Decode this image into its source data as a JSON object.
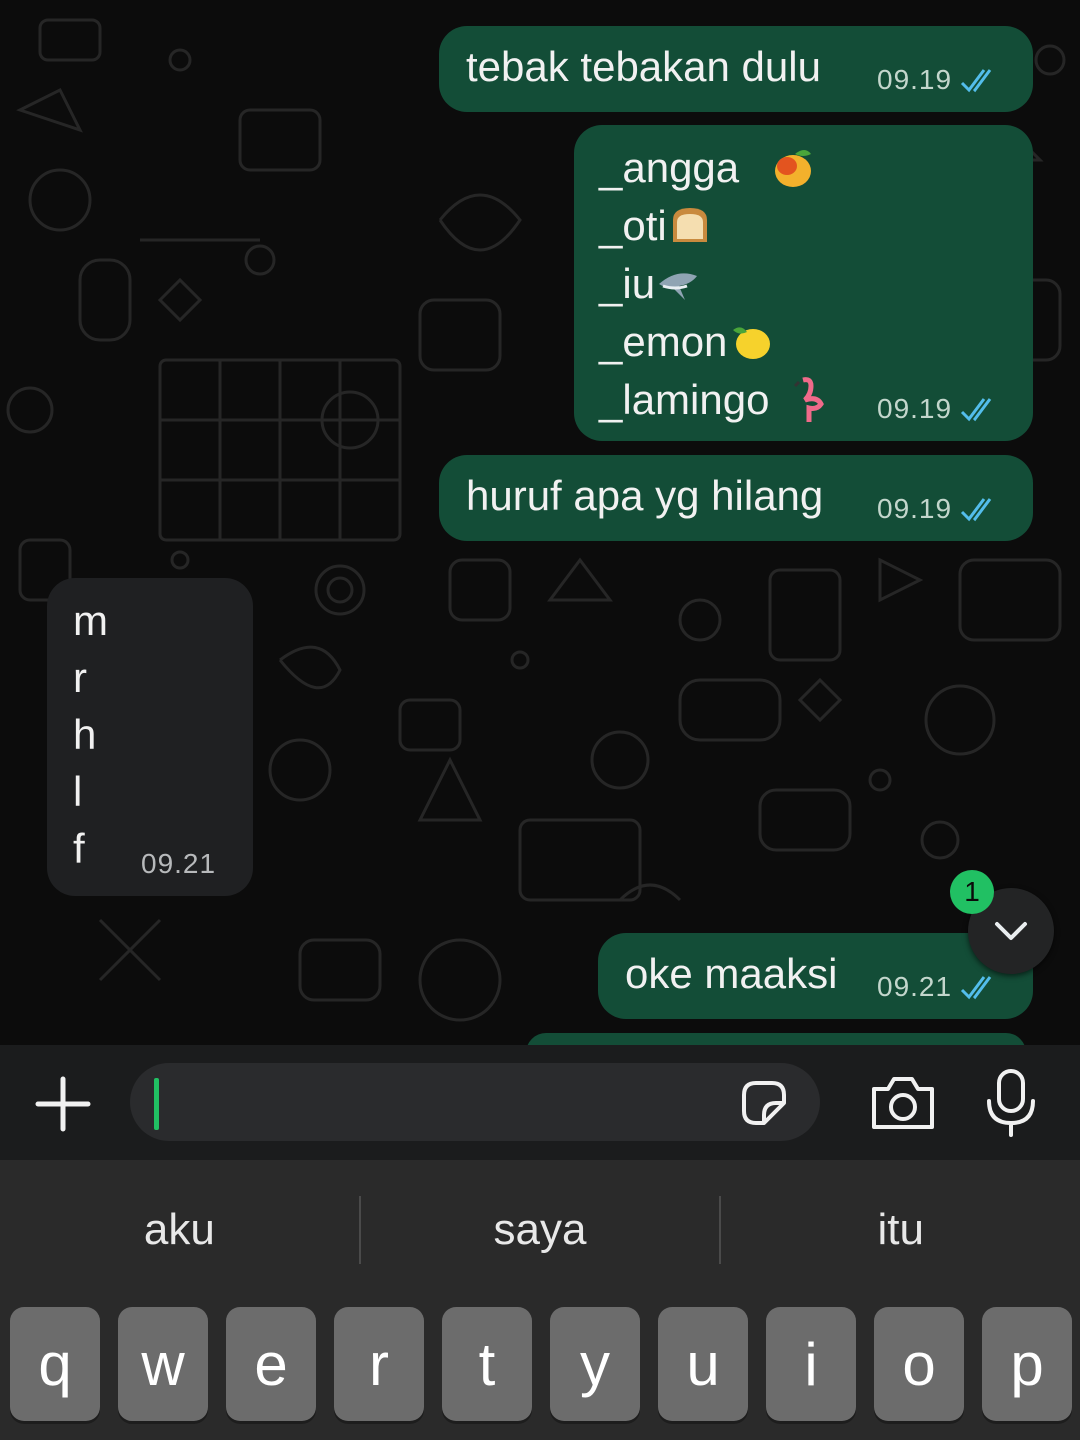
{
  "chat": {
    "messages": [
      {
        "direction": "out",
        "lines": [
          "tebak tebakan dulu"
        ],
        "time": "09.19",
        "status": "read"
      },
      {
        "direction": "out",
        "lines": [
          "_angga",
          "_oti",
          "_iu",
          "_emon",
          "_lamingo"
        ],
        "emojis": [
          "mango",
          "bread",
          "shark",
          "lemon",
          "flamingo"
        ],
        "time": "09.19",
        "status": "read"
      },
      {
        "direction": "out",
        "lines": [
          "huruf apa yg hilang"
        ],
        "time": "09.19",
        "status": "read"
      },
      {
        "direction": "in",
        "lines": [
          "m",
          "r",
          "h",
          "l",
          "f"
        ],
        "time": "09.21"
      },
      {
        "direction": "out",
        "lines": [
          "oke maaksi"
        ],
        "time": "09.21",
        "status": "read"
      }
    ],
    "unread_count": "1",
    "scroll_icon": "chevron-down-icon"
  },
  "input_bar": {
    "icons": [
      "plus-icon",
      "sticker-icon",
      "camera-icon",
      "microphone-icon"
    ],
    "value": ""
  },
  "keyboard": {
    "suggestions": [
      "aku",
      "saya",
      "itu"
    ],
    "keys": [
      "q",
      "w",
      "e",
      "r",
      "t",
      "y",
      "u",
      "i",
      "o",
      "p"
    ]
  },
  "colors": {
    "outgoing_bubble": "#134d37",
    "incoming_bubble": "#1f2022",
    "read_ticks": "#53bdeb",
    "accent_green": "#21c063"
  }
}
